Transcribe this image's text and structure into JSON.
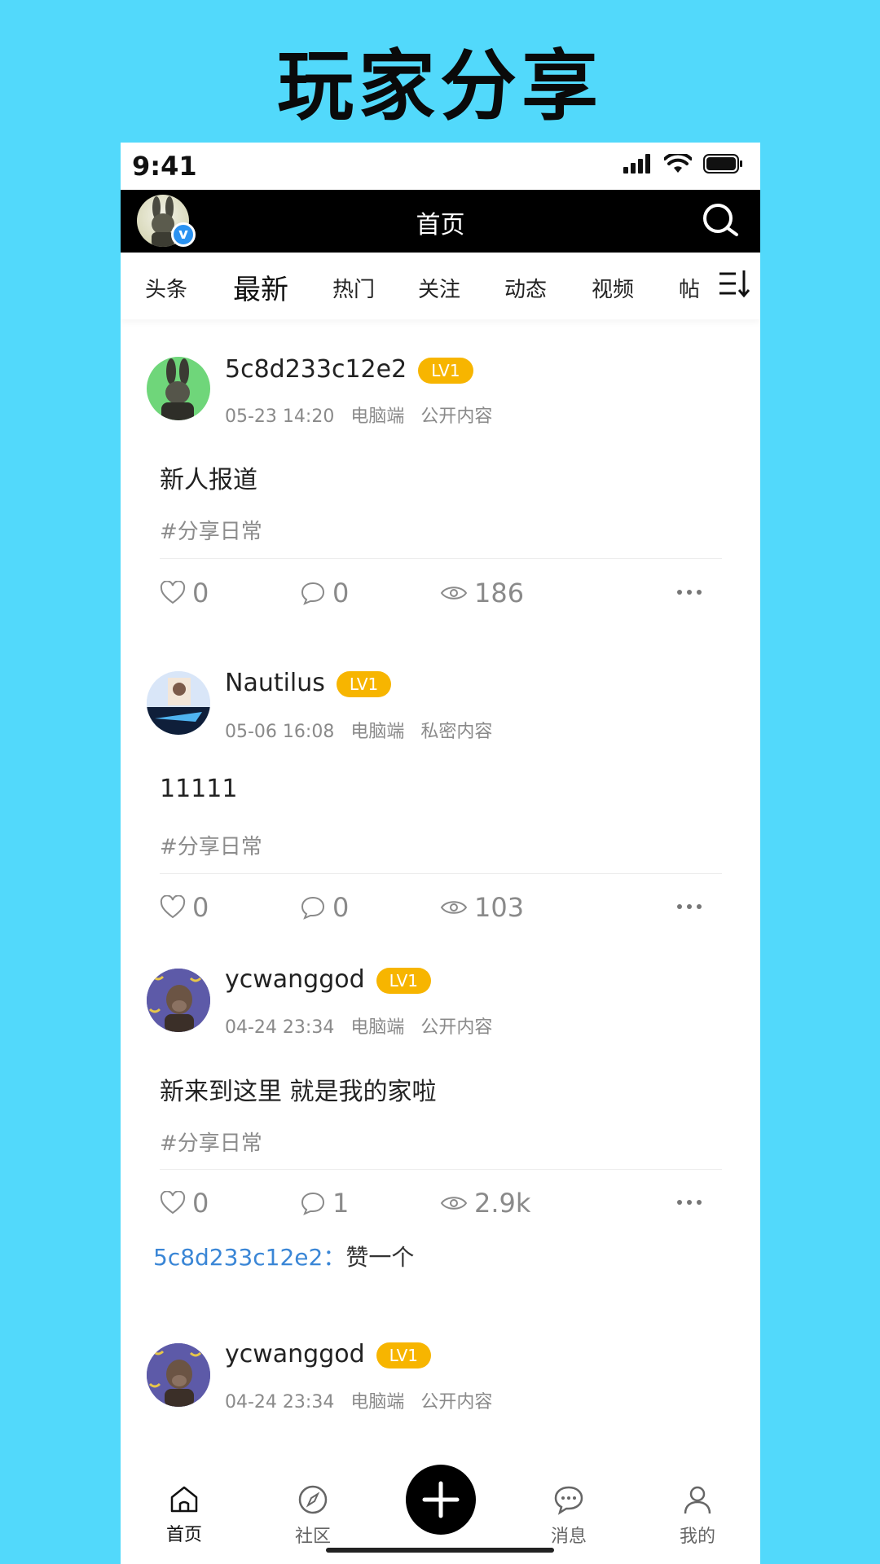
{
  "headline": "玩家分享",
  "status_bar": {
    "time": "9:41"
  },
  "nav": {
    "title": "首页"
  },
  "tabs": [
    "头条",
    "最新",
    "热门",
    "关注",
    "动态",
    "视频",
    "帖"
  ],
  "active_tab_index": 1,
  "posts": [
    {
      "username": "5c8d233c12e2",
      "level": "LV1",
      "time": "05-23 14:20",
      "device": "电脑端",
      "visibility": "公开内容",
      "content": "新人报道",
      "tag": "#分享日常",
      "likes": "0",
      "comments": "0",
      "views": "186",
      "avatar_icon": "rabbit-avatar"
    },
    {
      "username": "Nautilus",
      "level": "LV1",
      "time": "05-06 16:08",
      "device": "电脑端",
      "visibility": "私密内容",
      "content": "11111",
      "tag": "#分享日常",
      "likes": "0",
      "comments": "0",
      "views": "103",
      "avatar_icon": "anime-avatar"
    },
    {
      "username": "ycwanggod",
      "level": "LV1",
      "time": "04-24 23:34",
      "device": "电脑端",
      "visibility": "公开内容",
      "content": "新来到这里 就是我的家啦",
      "tag": "#分享日常",
      "likes": "0",
      "comments": "1",
      "views": "2.9k",
      "reply": {
        "author": "5c8d233c12e2",
        "separator": "：",
        "text": "赞一个"
      },
      "avatar_icon": "ape-avatar"
    },
    {
      "username": "ycwanggod",
      "level": "LV1",
      "time": "04-24 23:34",
      "device": "电脑端",
      "visibility": "公开内容",
      "avatar_icon": "ape-avatar"
    }
  ],
  "tabbar": {
    "home": "首页",
    "community": "社区",
    "messages": "消息",
    "mine": "我的"
  },
  "colors": {
    "background": "#52d9fb",
    "level_badge": "#f7b500",
    "link": "#3a86d6",
    "verified_badge": "#2a92f1"
  }
}
